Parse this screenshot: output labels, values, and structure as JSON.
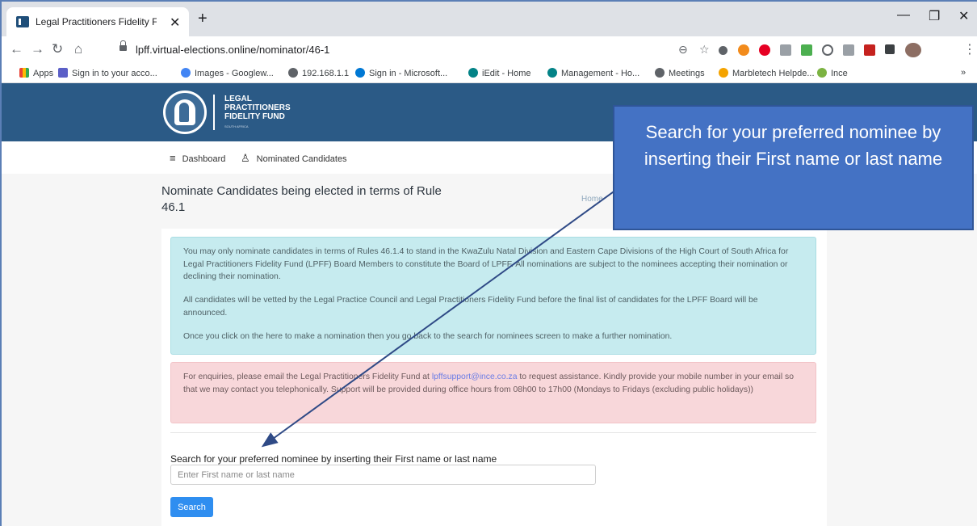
{
  "browser": {
    "tab_title": "Legal Practitioners Fidelity Fund",
    "url": "lpff.virtual-elections.online/nominator/46-1",
    "bookmarks": [
      "Apps",
      "Sign in to your acco...",
      "Images - Googlew...",
      "192.168.1.1",
      "Sign in - Microsoft...",
      "iEdit - Home",
      "Management - Ho...",
      "Meetings",
      "Marbletech Helpde...",
      "Ince"
    ],
    "bookmarks_overflow": "»"
  },
  "site": {
    "logo_lines": [
      "LEGAL",
      "PRACTITIONERS",
      "FIDELITY FUND"
    ],
    "logo_sub": "SOUTH AFRICA",
    "nav": [
      "Dashboard",
      "Nominated Candidates"
    ]
  },
  "main": {
    "title": "Nominate Candidates being elected in terms of Rule 46.1",
    "breadcrumb": "Home",
    "info_paragraphs": [
      "You may only nominate candidates in terms of Rules 46.1.4 to stand in the KwaZulu Natal Division and Eastern Cape Divisions of the High Court of South Africa for Legal Practitioners Fidelity Fund (LPFF) Board Members to constitute the Board of LPFF. All nominations are subject to the nominees accepting their nomination or declining their nomination.",
      "All candidates will be vetted by the Legal Practice Council and Legal Practitioners Fidelity Fund before the final list of candidates for the LPFF Board will be announced.",
      "Once you click on the here to make a nomination then you go back to the search for nominees screen to make a further nomination."
    ],
    "enquiry_before": "For enquiries, please email the Legal Practitioners Fidelity Fund at ",
    "enquiry_email": "lpffsupport@ince.co.za",
    "enquiry_after": " to request assistance. Kindly provide your mobile number in your email so that we may contact you telephonically. Support will be provided during office hours from 08h00 to 17h00 (Mondays to Fridays (excluding public holidays))",
    "search_label": "Search for your preferred nominee by inserting their First name or last name",
    "search_placeholder": "Enter First name or last name",
    "search_button": "Search"
  },
  "callout": {
    "text": "Search for your preferred nominee by inserting their First name or last name"
  },
  "colors": {
    "header_blue": "#2b5a86",
    "callout_blue": "#4472c4",
    "button_blue": "#2f8ef0",
    "info_bg": "#c6ebef",
    "danger_bg": "#f8d7da"
  }
}
